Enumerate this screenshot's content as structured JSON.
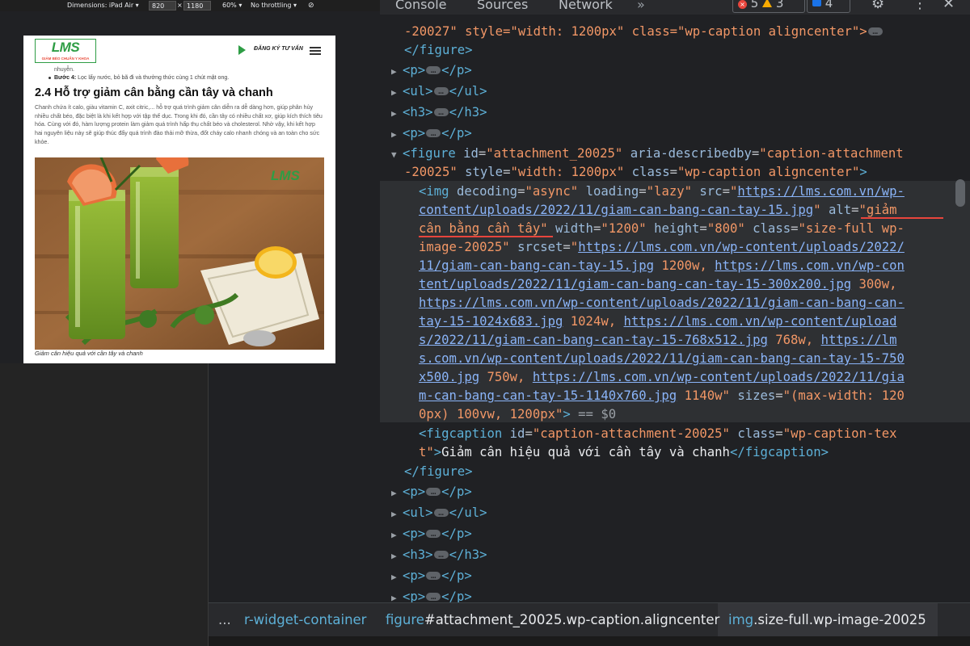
{
  "device_toolbar": {
    "dimensions": "Dimensions: iPad Air",
    "width": "820",
    "x": "×",
    "height": "1180",
    "zoom": "60%",
    "throttling": "No throttling"
  },
  "preview": {
    "logo": "LMS",
    "logo_sub": "GIẢM BÉO CHUẨN Y KHOA",
    "cta": "ĐĂNG KÝ TƯ VẤN",
    "prev_line": "nhuyễn.",
    "step4_label": "Bước 4:",
    "step4_text": " Lọc lấy nước, bỏ bã đi và thưởng thức cùng 1 chút mật ong.",
    "heading": "2.4 Hỗ trợ giảm cân bằng cần tây và chanh",
    "paragraph": "Chanh chứa ít calo, giàu vitamin C, axit citric,... hỗ trợ quá trình giảm cân diễn ra dễ dàng hơn, giúp phân hủy nhiều chất béo, đặc biệt là khi kết hợp với tập thể dục. Trong khi đó, cần tây có nhiều chất xơ, giúp kích thích tiêu hóa. Cùng với đó, hàm lượng protein làm giảm quá trình hấp thụ chất béo và cholesterol. Nhờ vậy, khi kết hợp hai nguyên liệu này sẽ giúp thúc đẩy quá trình đào thải mỡ thừa, đốt cháy calo nhanh chóng và an toàn cho sức khỏe.",
    "photo_watermark": "LMS",
    "caption": "Giảm cân hiệu quả với cần tây và chanh"
  },
  "devtools": {
    "tabs": [
      "Console",
      "Sources",
      "Network"
    ],
    "more": "»",
    "errors": "5",
    "warnings": "3",
    "messages": "4"
  },
  "elements": {
    "l0": "-20027\" style=\"width: 1200px\" class=\"wp-caption aligncenter\">",
    "fig_close": "</figure>",
    "p": "p",
    "ul": "ul",
    "h3": "h3",
    "fig_open_1": "figure",
    "fig_id_attr": "id",
    "fig_id_val": "\"attachment_20025\"",
    "fig_aria_attr": "aria-describedby",
    "fig_aria_val": "\"caption-attachment",
    "fig_line2": "-20025\"",
    "fig_style_attr": "style",
    "fig_style_val": "\"width: 1200px\"",
    "fig_class_attr": "class",
    "fig_class_val": "\"wp-caption aligncenter\"",
    "img_tag": "img",
    "img_decoding": "decoding",
    "img_decoding_val": "\"async\"",
    "img_loading": "loading",
    "img_loading_val": "\"lazy\"",
    "img_src": "src",
    "src_l1": "https://lms.com.vn/wp-",
    "src_l2": "content/uploads/2022/11/giam-can-bang-can-tay-15.jpg",
    "alt_attr": "alt",
    "alt_l1": "\"giảm",
    "alt_l2": "cân bằng cần tây\"",
    "width_attr": "width",
    "width_val": "\"1200\"",
    "height_attr": "height",
    "height_val": "\"800\"",
    "class_attr": "class",
    "class_l1": "\"size-full wp-",
    "class_l2": "image-20025\"",
    "srcset_attr": "srcset",
    "srcset_l1": "https://lms.com.vn/wp-content/uploads/2022/",
    "srcset_l2a": "11/giam-can-bang-can-tay-15.jpg",
    "srcset_l2b": " 1200w, ",
    "srcset_l2c": "https://lms.com.vn/wp-con",
    "srcset_l3a": "tent/uploads/2022/11/giam-can-bang-can-tay-15-300x200.jpg",
    "srcset_l3b": " 300w,",
    "srcset_l4": "https://lms.com.vn/wp-content/uploads/2022/11/giam-can-bang-can-",
    "srcset_l5a": "tay-15-1024x683.jpg",
    "srcset_l5b": " 1024w, ",
    "srcset_l5c": "https://lms.com.vn/wp-content/upload",
    "srcset_l6a": "s/2022/11/giam-can-bang-can-tay-15-768x512.jpg",
    "srcset_l6b": " 768w, ",
    "srcset_l6c": "https://lm",
    "srcset_l7": "s.com.vn/wp-content/uploads/2022/11/giam-can-bang-can-tay-15-750",
    "srcset_l8a": "x500.jpg",
    "srcset_l8b": " 750w, ",
    "srcset_l8c": "https://lms.com.vn/wp-content/uploads/2022/11/gia",
    "srcset_l9a": "m-can-bang-can-tay-15-1140x760.jpg",
    "srcset_l9b": " 1140w\"",
    "sizes_attr": "sizes",
    "sizes_l1": "\"(max-width: 120",
    "sizes_l2": "0px) 100vw, 1200px\"",
    "dollar0": "== $0",
    "figcaption_tag": "figcaption",
    "figcaption_id": "id",
    "figcaption_id_val": "\"caption-attachment-20025\"",
    "figcaption_class": "class",
    "figcaption_class_val": "\"wp-caption-tex",
    "figcaption_l2a": "t\"",
    "figcaption_text": "Giảm cân hiệu quả với cần tây và chanh",
    "figcaption_close": "figcaption"
  },
  "breadcrumbs": {
    "more": "...",
    "c1": "r-widget-container",
    "c2_tag": "figure",
    "c2_rest": "#attachment_20025.wp-caption.aligncenter",
    "c3_tag": "img",
    "c3_rest": ".size-full.wp-image-20025"
  }
}
